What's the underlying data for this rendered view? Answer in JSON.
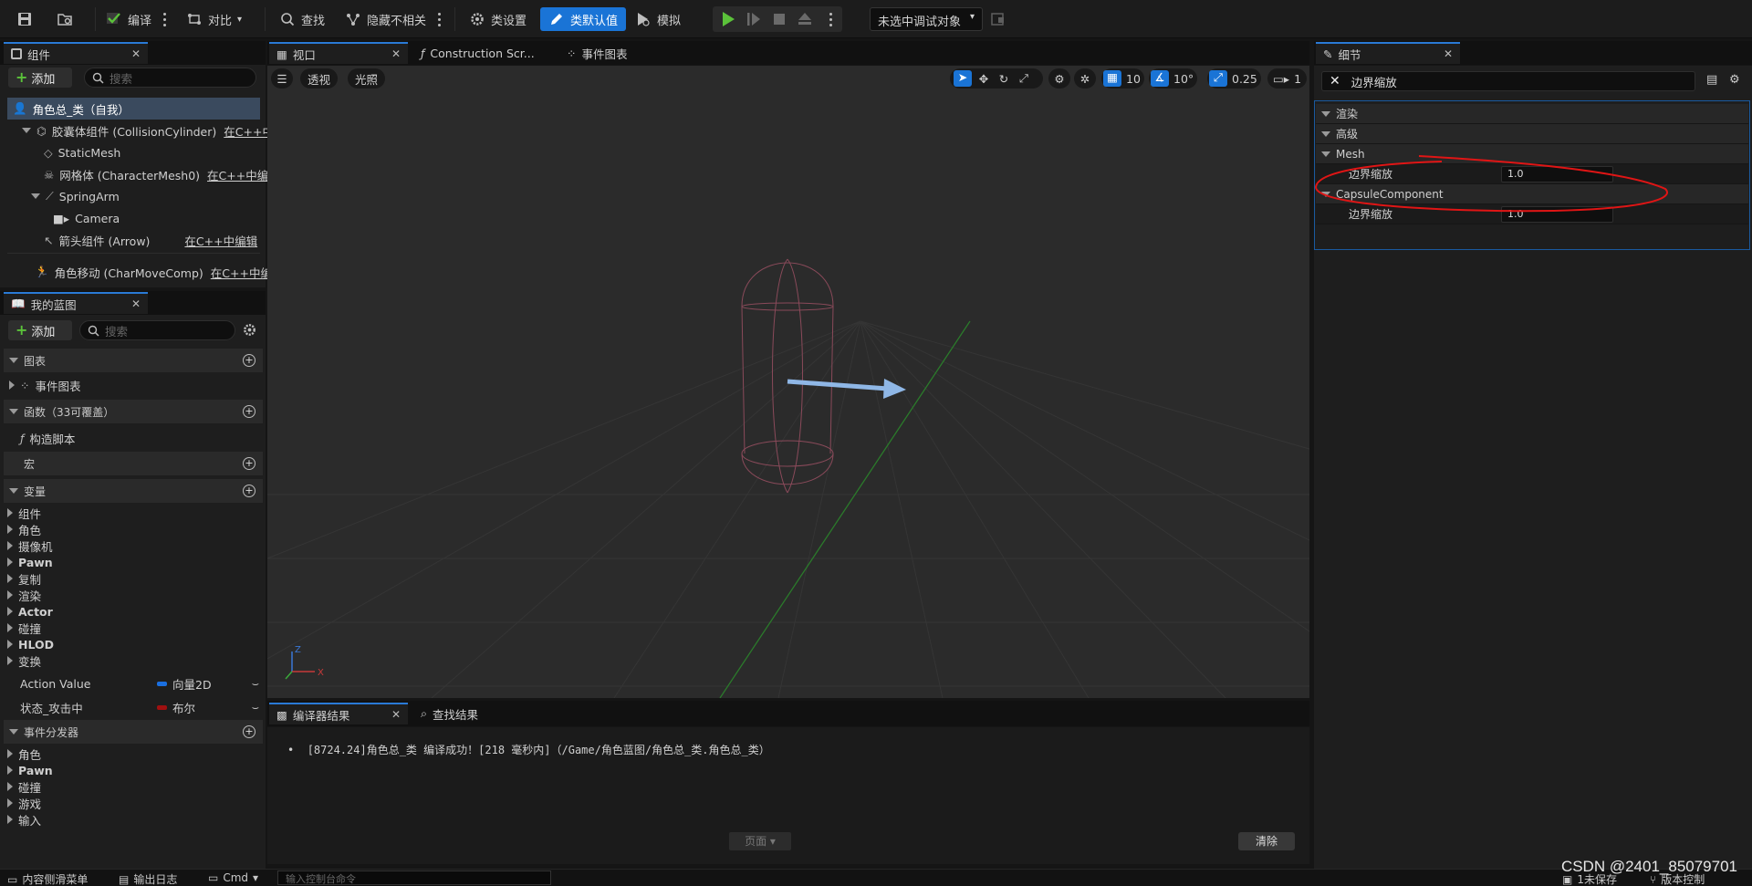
{
  "toolbar": {
    "compile": "编译",
    "diff": "对比",
    "find": "查找",
    "hide_unrelated": "隐藏不相关",
    "class_settings": "类设置",
    "class_defaults": "类默认值",
    "simulate": "模拟",
    "debug_target": "未选中调试对象"
  },
  "components_panel": {
    "tab": "组件",
    "add": "添加",
    "search_placeholder": "搜索",
    "root": "角色总_类（自我）",
    "items": [
      {
        "label": "胶囊体组件 (CollisionCylinder)",
        "link": "在C++中"
      },
      {
        "label": "StaticMesh",
        "link": ""
      },
      {
        "label": "网格体 (CharacterMesh0)",
        "link": "在C++中编"
      },
      {
        "label": "SpringArm",
        "link": ""
      },
      {
        "label": "Camera",
        "link": ""
      },
      {
        "label": "箭头组件 (Arrow)",
        "link": "在C++中编辑"
      },
      {
        "label": "角色移动 (CharMoveComp)",
        "link": "在C++中编"
      }
    ]
  },
  "blueprint_panel": {
    "tab": "我的蓝图",
    "add": "添加",
    "search_placeholder": "搜索",
    "graphs_header": "图表",
    "event_graph": "事件图表",
    "functions_header": "函数（33可覆盖）",
    "construction_script": "构造脚本",
    "macros_header": "宏",
    "variables_header": "变量",
    "variable_groups": [
      "组件",
      "角色",
      "摄像机",
      "Pawn",
      "复制",
      "渲染",
      "Actor",
      "碰撞",
      "HLOD",
      "变换"
    ],
    "variables": [
      {
        "name": "Action Value",
        "type": "向量2D",
        "color": "#1a6fe0"
      },
      {
        "name": "状态_攻击中",
        "type": "布尔",
        "color": "#a01010"
      }
    ],
    "dispatchers_header": "事件分发器",
    "dispatcher_groups": [
      "角色",
      "Pawn",
      "碰撞",
      "游戏",
      "输入"
    ]
  },
  "center_tabs": {
    "viewport": "视口",
    "construction": "Construction Scr...",
    "event_graph": "事件图表"
  },
  "viewport_bar": {
    "perspective": "透视",
    "lighting": "光照",
    "grid_snap": "10",
    "rotation_snap": "10°",
    "scale_snap": "0.25",
    "camera_speed": "1"
  },
  "details_panel": {
    "tab": "细节",
    "search_value": "边界缩放",
    "rows": [
      {
        "kind": "cat",
        "label": "渲染"
      },
      {
        "kind": "cat",
        "label": "高级"
      },
      {
        "kind": "cat",
        "label": "Mesh"
      },
      {
        "kind": "prop",
        "label": "边界缩放",
        "value": "1.0"
      },
      {
        "kind": "cat",
        "label": "CapsuleComponent"
      },
      {
        "kind": "prop",
        "label": "边界缩放",
        "value": "1.0"
      }
    ]
  },
  "output_panel": {
    "tab_compiler": "编译器结果",
    "tab_find": "查找结果",
    "log_line": "[8724.24]角色总_类 编译成功！[218 毫秒内]（/Game/角色蓝图/角色总_类.角色总_类）",
    "page": "页面",
    "clear": "清除"
  },
  "statusbar": {
    "content_drawer": "内容侧滑菜单",
    "output_log": "输出日志",
    "cmd": "Cmd",
    "console_placeholder": "输入控制台命令",
    "unsaved": "1未保存",
    "source_control": "版本控制"
  },
  "watermark": "CSDN @2401_85079701",
  "colors": {
    "accent": "#1a74d6",
    "play": "#5bc23a",
    "annotation": "#e01515"
  }
}
